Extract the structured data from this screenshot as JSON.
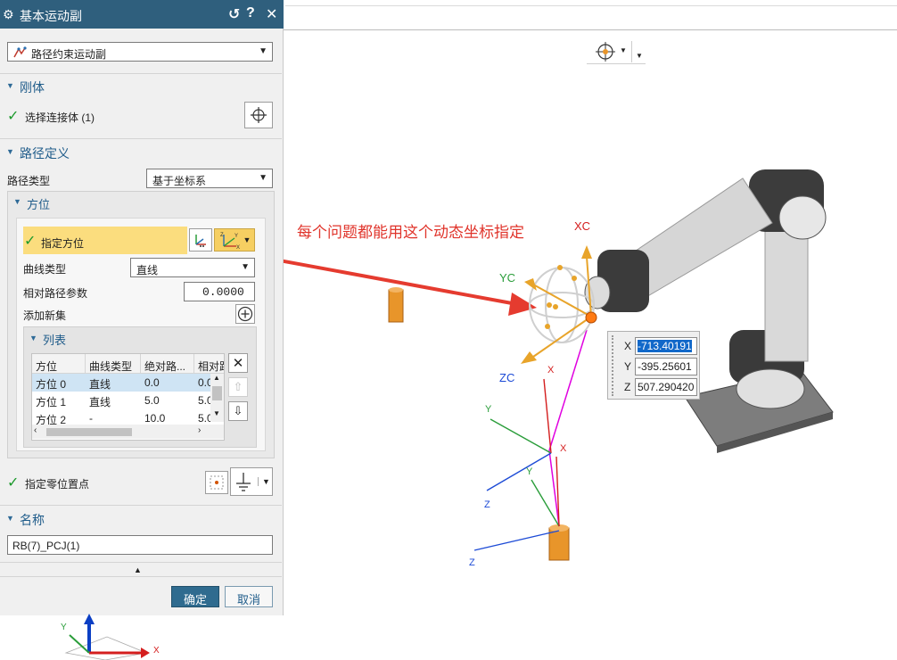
{
  "dialog": {
    "title": "基本运动副",
    "reset_glyph": "↺",
    "help_glyph": "?",
    "close_glyph": "✕",
    "joint_type": "路径约束运动副",
    "sections": {
      "rigid_body": {
        "title": "刚体",
        "select_label": "选择连接体 (1)"
      },
      "path_definition": {
        "title": "路径定义",
        "path_type_label": "路径类型",
        "path_type_value": "基于坐标系",
        "orientation": {
          "title": "方位",
          "specify_label": "指定方位",
          "curve_type_label": "曲线类型",
          "curve_type_value": "直线",
          "param_label": "相对路径参数",
          "param_value": "0.0000",
          "add_label": "添加新集",
          "list": {
            "title": "列表",
            "columns": [
              "方位",
              "曲线类型",
              "绝对路...",
              "相对路"
            ],
            "rows": [
              [
                "方位 0",
                "直线",
                "0.0",
                "0.0"
              ],
              [
                "方位 1",
                "直线",
                "5.0",
                "5.0"
              ],
              [
                "方位 2",
                "-",
                "10.0",
                "5.0"
              ]
            ]
          }
        },
        "zero_point_label": "指定零位置点"
      },
      "name": {
        "title": "名称",
        "value": "RB(7)_PCJ(1)"
      }
    },
    "ok_label": "确定",
    "cancel_label": "取消",
    "collapse_glyph": "▲"
  },
  "viewport": {
    "annotation": "每个问题都能用这个动态坐标指定",
    "handle_labels": {
      "xc": "XC",
      "yc": "YC",
      "zc": "ZC"
    },
    "coord_input": {
      "x_label": "X",
      "x_value": "-713.40191",
      "y_label": "Y",
      "y_value": "-395.25601",
      "z_label": "Z",
      "z_value": "507.290420"
    },
    "axis_labels": {
      "x": "X",
      "y": "Y",
      "z": "Z"
    }
  },
  "colors": {
    "title_bar": "#2f5f7d",
    "highlight": "#fbdd7e",
    "section_text": "#1f5c8a",
    "check_green": "#1c9a2c",
    "annotation_red": "#e0342b",
    "ok_button": "#2f6b8f",
    "link_orange": "#e8952a"
  },
  "icons": [
    "gear-icon",
    "reset-icon",
    "help-icon",
    "close-icon",
    "path-joint-icon",
    "crosshair-icon",
    "csys-icon",
    "dynamic-csys-icon",
    "plus-circle-icon",
    "delete-icon",
    "up-arrow-icon",
    "down-arrow-icon",
    "point-icon",
    "ground-icon",
    "snap-icon"
  ]
}
